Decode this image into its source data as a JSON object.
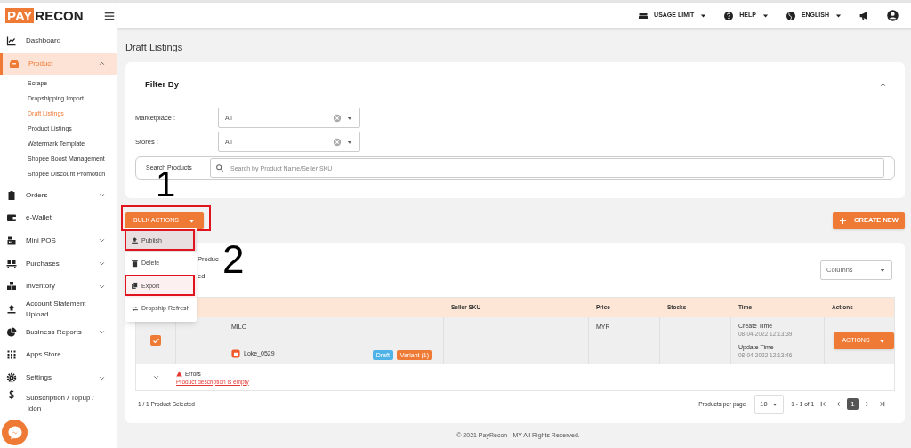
{
  "logo": {
    "part_1": "PAY",
    "part_2": "RECON"
  },
  "header": {
    "items": [
      {
        "label": "USAGE LIMIT"
      },
      {
        "label": "HELP"
      },
      {
        "label": "ENGLISH"
      }
    ]
  },
  "sidebar": {
    "items": [
      {
        "label": "Dashboard",
        "selected": false,
        "expandable": false
      },
      {
        "label": "Product",
        "selected": true,
        "expandable": true,
        "expanded": true,
        "children": [
          {
            "label": "Scrape",
            "selected": false
          },
          {
            "label": "Dropshipping Import",
            "selected": false
          },
          {
            "label": "Draft Listings",
            "selected": true
          },
          {
            "label": "Product Listings",
            "selected": false
          },
          {
            "label": "Watermark Template",
            "selected": false
          },
          {
            "label": "Shopee Boost Management",
            "selected": false
          },
          {
            "label": "Shopee Discount Promotion",
            "selected": false
          }
        ]
      },
      {
        "label": "Orders",
        "selected": false,
        "expandable": true,
        "expanded": false
      },
      {
        "label": "e-Wallet",
        "selected": false,
        "expandable": false
      },
      {
        "label": "Mini POS",
        "selected": false,
        "expandable": true,
        "expanded": false
      },
      {
        "label": "Purchases",
        "selected": false,
        "expandable": true,
        "expanded": false
      },
      {
        "label": "Inventory",
        "selected": false,
        "expandable": true,
        "expanded": false
      },
      {
        "label": "Account Statement Upload",
        "selected": false,
        "expandable": false
      },
      {
        "label": "Business Reports",
        "selected": false,
        "expandable": true,
        "expanded": false
      },
      {
        "label": "Apps Store",
        "selected": false,
        "expandable": false
      },
      {
        "label": "Settings",
        "selected": false,
        "expandable": true,
        "expanded": false
      },
      {
        "label": "Subscription / Topup /",
        "label_2": "ldon",
        "selected": false,
        "expandable": false
      }
    ]
  },
  "page_title": "Draft Listings",
  "filter": {
    "title": "Filter By",
    "expanded": true,
    "fields": [
      {
        "label": "Marketplace :",
        "value": "All"
      },
      {
        "label": "Stores :",
        "value": "All"
      }
    ],
    "search": {
      "label": "Search Products",
      "placeholder": "Search by Product Name/Seller SKU"
    }
  },
  "bulk_actions": {
    "label": "BULK ACTIONS",
    "annotated": true,
    "annotation": "1",
    "menu": [
      {
        "label": "Publish",
        "hovered": true,
        "annotated": true
      },
      {
        "label": "Delete",
        "hovered": false,
        "annotated": false
      },
      {
        "label": "Export",
        "hovered": false,
        "annotated": true
      },
      {
        "label": "Dropship Refresh",
        "hovered": false,
        "annotated": false
      }
    ],
    "menu_annotation": "2"
  },
  "create_button": "CREATE NEW",
  "list": {
    "hidden_text_1": "Produc",
    "hidden_text_2": "ed",
    "columns_select": "Columns",
    "table": {
      "columns": [
        "Seller SKU",
        "Price",
        "Stocks",
        "Time",
        "Actions"
      ],
      "rows": [
        {
          "checked": true,
          "name": "MILO",
          "store": "Loke_0529",
          "badges": [
            {
              "label": "Draft",
              "color": "#4fb3e8"
            },
            {
              "label": "Variant (1)",
              "color": "#ef7a35"
            }
          ],
          "seller_sku": "",
          "price": "MYR",
          "create_label": "Create Time",
          "create_time": "08-04-2022 12:13:39",
          "update_label": "Update Time",
          "update_time": "08-04-2022 12:13:46",
          "action": "ACTIONS",
          "expanded": false,
          "error_title": "Errors",
          "error": "Product description is empty"
        }
      ]
    },
    "selected_count": "1 / 1 Product Selected",
    "per_page_label": "Products per page",
    "per_page": "10",
    "range": "1 - 1 of 1",
    "pages": [
      {
        "label": "1",
        "selected": true
      }
    ]
  },
  "footer": "© 2021 PayRecon - MY All Rights Reserved."
}
